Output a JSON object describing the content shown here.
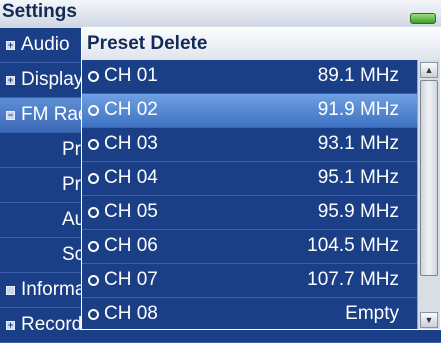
{
  "header": {
    "title": "Settings"
  },
  "background_menu": {
    "items": [
      {
        "label": "Audio",
        "marker": "+",
        "level": 0,
        "selected": false
      },
      {
        "label": "Display",
        "marker": "+",
        "level": 0,
        "selected": false
      },
      {
        "label": "FM Radio",
        "marker": "−",
        "level": 0,
        "selected": true
      },
      {
        "label": "Preset Save",
        "marker": "",
        "level": 1,
        "selected": false
      },
      {
        "label": "Preset Delete",
        "marker": "",
        "level": 1,
        "selected": false
      },
      {
        "label": "Auto Preset",
        "marker": "",
        "level": 1,
        "selected": false
      },
      {
        "label": "Scan Sensitivity",
        "marker": "",
        "level": 1,
        "selected": false
      },
      {
        "label": "Information",
        "marker": "",
        "level": 0,
        "selected": false
      },
      {
        "label": "Record",
        "marker": "+",
        "level": 0,
        "selected": false
      }
    ]
  },
  "popup": {
    "title": "Preset Delete",
    "presets": [
      {
        "channel": "CH 01",
        "frequency": "89.1 MHz",
        "selected": false
      },
      {
        "channel": "CH 02",
        "frequency": "91.9 MHz",
        "selected": true
      },
      {
        "channel": "CH 03",
        "frequency": "93.1 MHz",
        "selected": false
      },
      {
        "channel": "CH 04",
        "frequency": "95.1 MHz",
        "selected": false
      },
      {
        "channel": "CH 05",
        "frequency": "95.9 MHz",
        "selected": false
      },
      {
        "channel": "CH 06",
        "frequency": "104.5 MHz",
        "selected": false
      },
      {
        "channel": "CH 07",
        "frequency": "107.7 MHz",
        "selected": false
      },
      {
        "channel": "CH 08",
        "frequency": "Empty",
        "selected": false
      }
    ],
    "scroll_position": 0.0,
    "visible_fraction": 0.85
  },
  "colors": {
    "background": "#1a3f86",
    "selection": "#4f80cc",
    "battery": "#5cc23f"
  }
}
